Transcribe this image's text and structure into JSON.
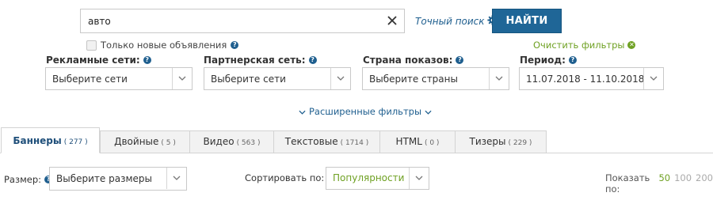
{
  "search": {
    "value": "авто",
    "exact_label": "Точный поиск",
    "submit_label": "НАЙТИ"
  },
  "only_new_label": "Только новые объявления",
  "clear_filters_label": "Очистить фильтры",
  "filters": {
    "ad_networks": {
      "label": "Рекламные сети:",
      "value": "Выберите сети"
    },
    "partner_network": {
      "label": "Партнерская сеть:",
      "value": "Выберите сети"
    },
    "country": {
      "label": "Страна показов:",
      "value": "Выберите страны"
    },
    "period": {
      "label": "Период:",
      "value": "11.07.2018 - 11.10.2018"
    }
  },
  "advanced_label": "Расширенные фильтры",
  "tabs": [
    {
      "label": "Баннеры",
      "count": "( 277 )",
      "active": true
    },
    {
      "label": "Двойные",
      "count": "( 5 )"
    },
    {
      "label": "Видео",
      "count": "( 563 )"
    },
    {
      "label": "Текстовые",
      "count": "( 1714 )"
    },
    {
      "label": "HTML",
      "count": "( 0 )"
    },
    {
      "label": "Тизеры",
      "count": "( 229 )"
    }
  ],
  "size": {
    "label": "Размер:",
    "value": "Выберите размеры"
  },
  "sort": {
    "label": "Сортировать по:",
    "value": "Популярности",
    "value_color": "#6fa123"
  },
  "page_size": {
    "label": "Показать по:",
    "options": [
      "50",
      "100",
      "200"
    ],
    "selected": "50"
  },
  "colors": {
    "accent": "#1f6697",
    "green": "#6fa123",
    "link": "#1f5f8f"
  }
}
